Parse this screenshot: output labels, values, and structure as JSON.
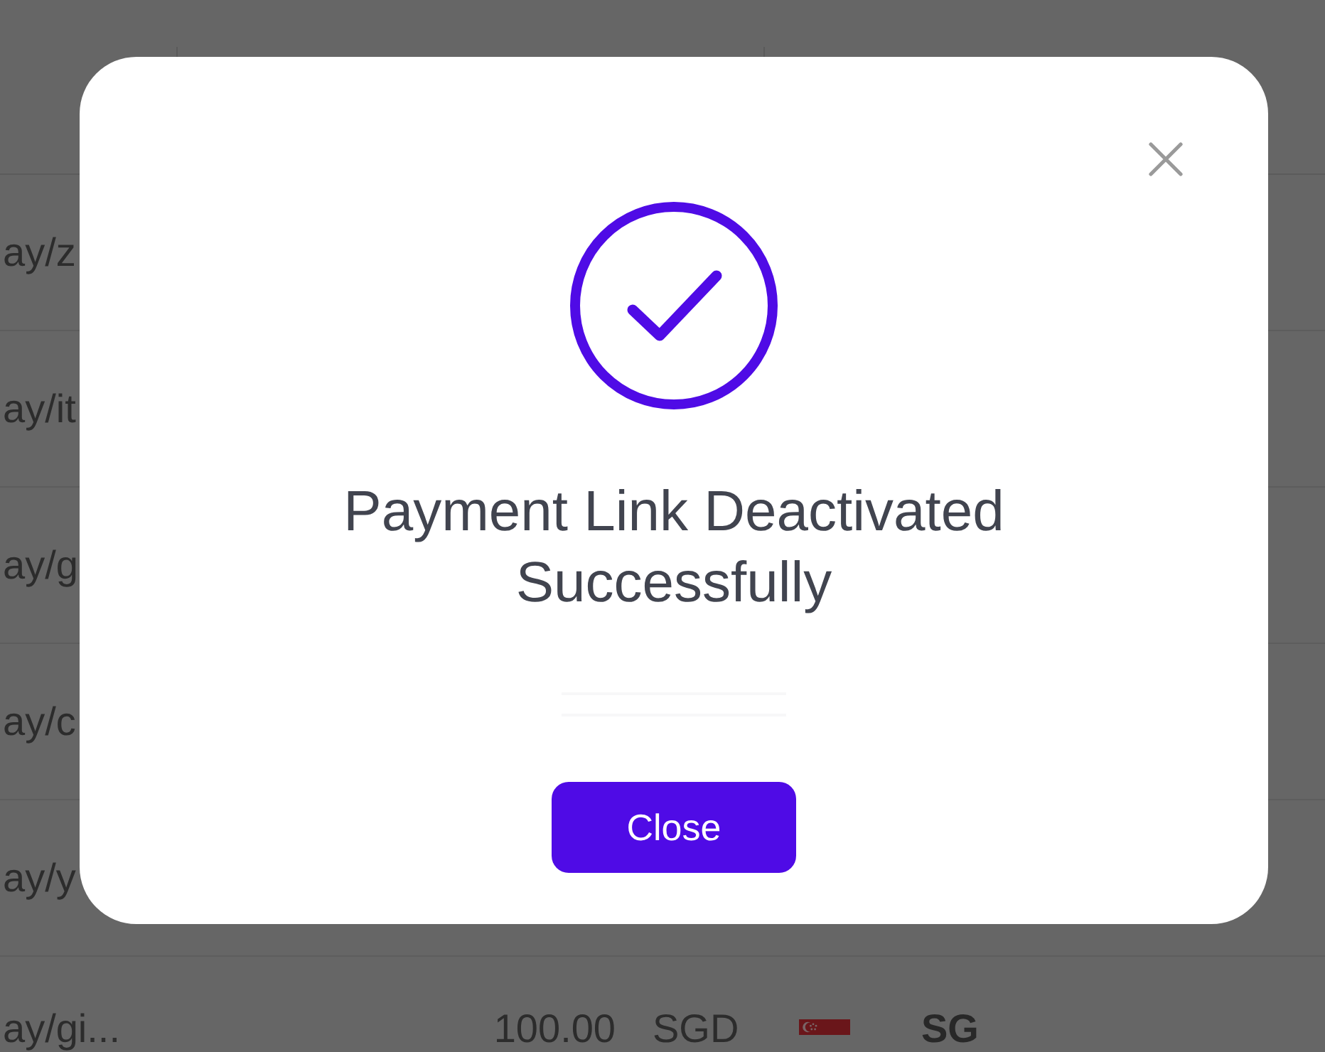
{
  "table": {
    "rows": [
      {
        "column_1": "ay/z"
      },
      {
        "column_1": "ay/it"
      },
      {
        "column_1": "ay/g"
      },
      {
        "column_1": "ay/c"
      },
      {
        "column_1": "ay/y"
      },
      {
        "column_1": "ay/gi...",
        "column_2": "100.00",
        "column_3": "SGD",
        "column_5": "SG"
      }
    ]
  },
  "dialog": {
    "title": "Payment Link Deactivated Successfully",
    "button": "Close"
  }
}
